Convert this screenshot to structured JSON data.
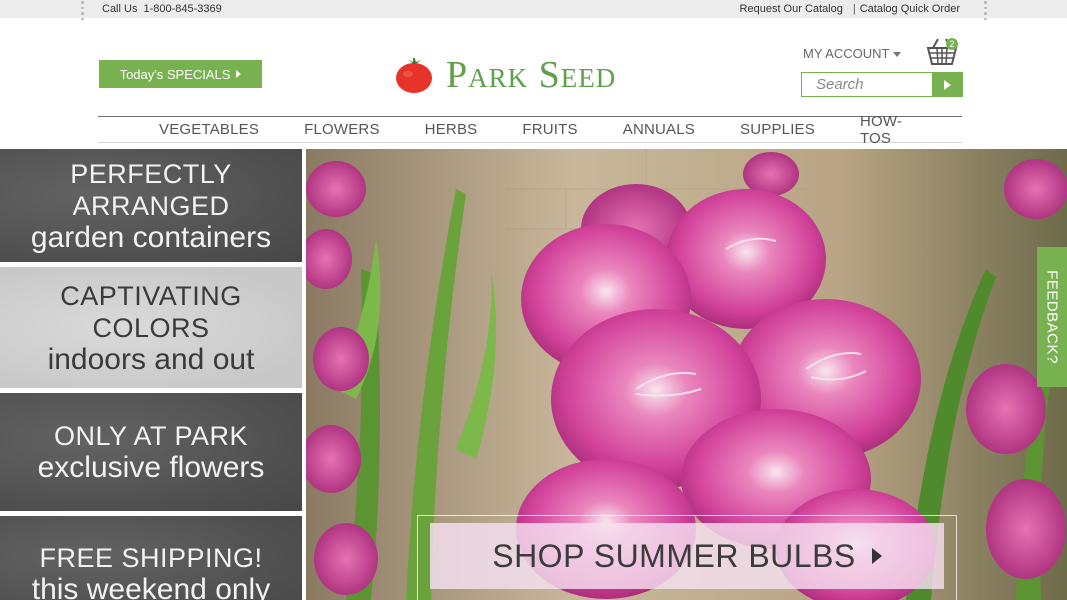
{
  "topbar": {
    "call_label": "Call Us",
    "phone": "1-800-845-3369",
    "request_catalog": "Request Our Catalog",
    "separator": "|",
    "catalog_quick_order": "Catalog Quick Order"
  },
  "header": {
    "specials_label": "Today's SPECIALS",
    "brand": "Park Seed",
    "account_label": "MY ACCOUNT",
    "cart_count": "2",
    "search_placeholder": "Search"
  },
  "nav": {
    "items": [
      {
        "label": "VEGETABLES"
      },
      {
        "label": "FLOWERS"
      },
      {
        "label": "HERBS"
      },
      {
        "label": "FRUITS"
      },
      {
        "label": "ANNUALS"
      },
      {
        "label": "SUPPLIES"
      },
      {
        "label": "HOW-TOS"
      }
    ]
  },
  "panels": [
    {
      "line1": "PERFECTLY ARRANGED",
      "line2": "garden containers",
      "style": "dark"
    },
    {
      "line1": "CAPTIVATING COLORS",
      "line2": "indoors and out",
      "style": "light"
    },
    {
      "line1": "ONLY AT PARK",
      "line2": "exclusive flowers",
      "style": "dark"
    },
    {
      "line1": "FREE SHIPPING!",
      "line2": "this weekend only",
      "style": "dark"
    }
  ],
  "hero": {
    "cta_label": "SHOP SUMMER BULBS"
  },
  "feedback_label": "FEEDBACK?",
  "colors": {
    "accent_green": "#78b150",
    "brand_green": "#5fa04a",
    "flower_pink": "#d9479a"
  },
  "icons": [
    "tomato-logo-icon",
    "basket-icon",
    "search-go-icon",
    "caret-down-icon"
  ]
}
